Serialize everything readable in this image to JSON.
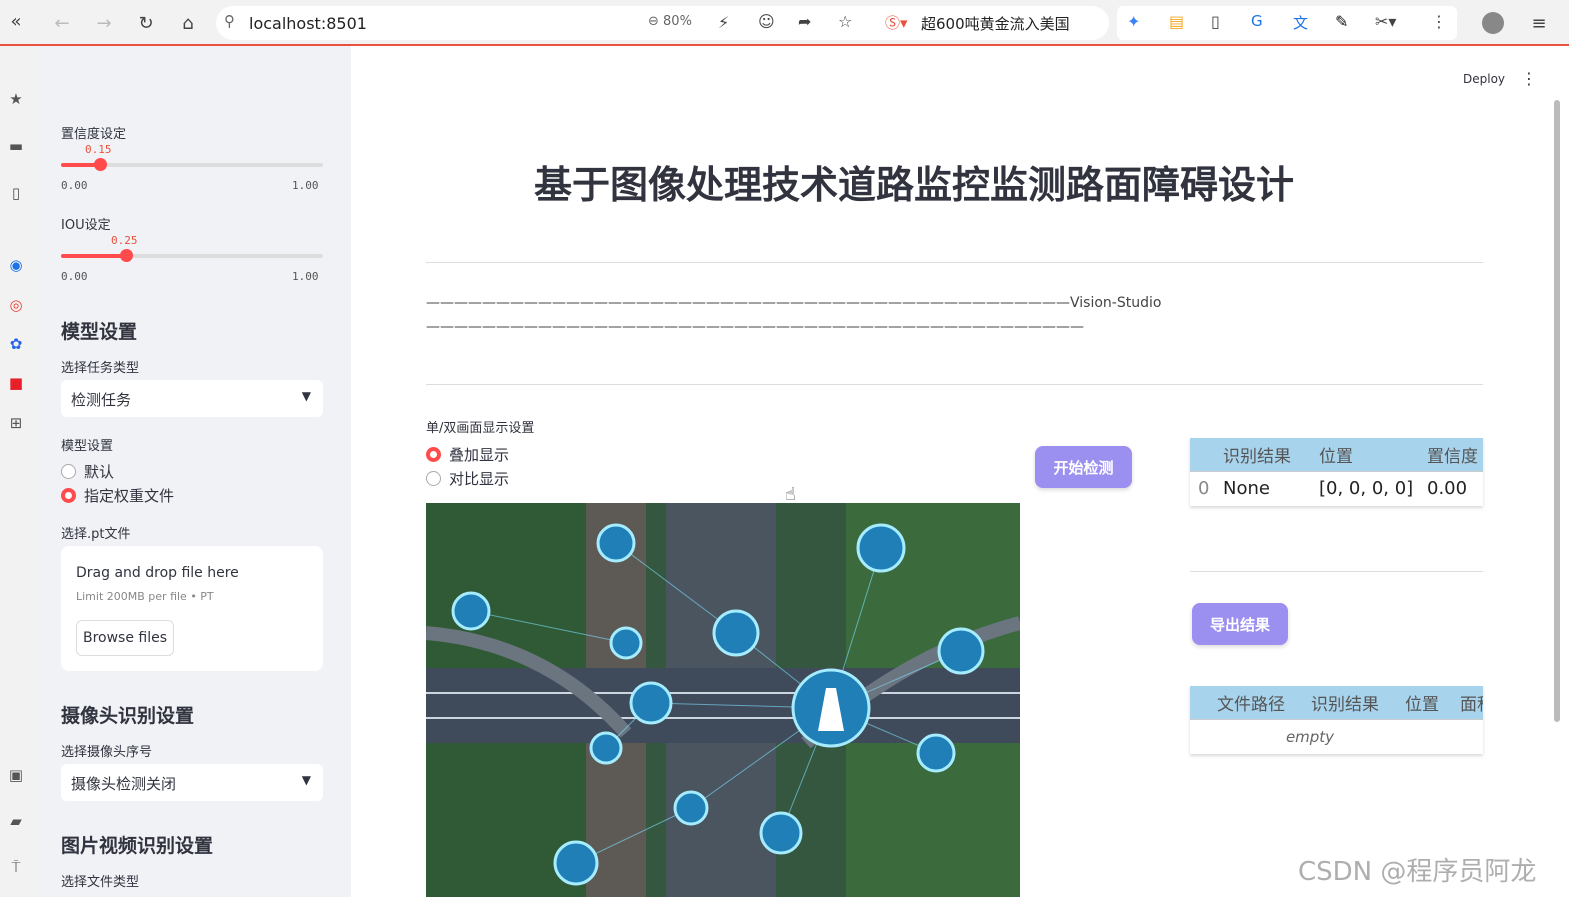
{
  "browser": {
    "url": "localhost:8501",
    "zoom": "80%",
    "news": "超600吨黄金流入美国"
  },
  "sidebar": {
    "confidence": {
      "label": "置信度设定",
      "value": "0.15",
      "min": "0.00",
      "max": "1.00",
      "fraction": 0.15
    },
    "iou": {
      "label": "IOU设定",
      "value": "0.25",
      "min": "0.00",
      "max": "1.00",
      "fraction": 0.25
    },
    "model_heading": "模型设置",
    "task_label": "选择任务类型",
    "task_value": "检测任务",
    "model_label": "模型设置",
    "model_options": [
      "默认",
      "指定权重文件"
    ],
    "model_selected": 1,
    "pt_label": "选择.pt文件",
    "upload_title": "Drag and drop file here",
    "upload_limit": "Limit 200MB per file • PT",
    "browse_label": "Browse files",
    "camera_heading": "摄像头识别设置",
    "camera_label": "选择摄像头序号",
    "camera_value": "摄像头检测关闭",
    "media_heading": "图片视频识别设置",
    "media_label": "选择文件类型"
  },
  "header": {
    "deploy_label": "Deploy",
    "menu_icon": "vertical-dots-icon"
  },
  "main": {
    "title": "基于图像处理技术道路监控监测路面障碍设计",
    "divider_line1": "——————————————————————————————————————————————Vision-Studio",
    "divider_line2": "———————————————————————————————————————————————",
    "display_label": "单/双画面显示设置",
    "display_options": [
      "叠加显示",
      "对比显示"
    ],
    "display_selected": 0,
    "start_button": "开始检测",
    "export_button": "导出结果",
    "result_table": {
      "headers": [
        "",
        "识别结果",
        "位置",
        "置信度"
      ],
      "rows": [
        [
          "0",
          "None",
          "[0, 0, 0, 0]",
          "0.00"
        ]
      ]
    },
    "export_table": {
      "headers": [
        "",
        "文件路径",
        "识别结果",
        "位置",
        "面积"
      ],
      "empty": "empty"
    }
  },
  "watermark": "CSDN @程序员阿龙",
  "colors": {
    "accent": "#ff4b4b",
    "button": "#9b8ff0",
    "table_header": "#a8d3ec",
    "sidebar_bg": "#f0f2f6"
  }
}
